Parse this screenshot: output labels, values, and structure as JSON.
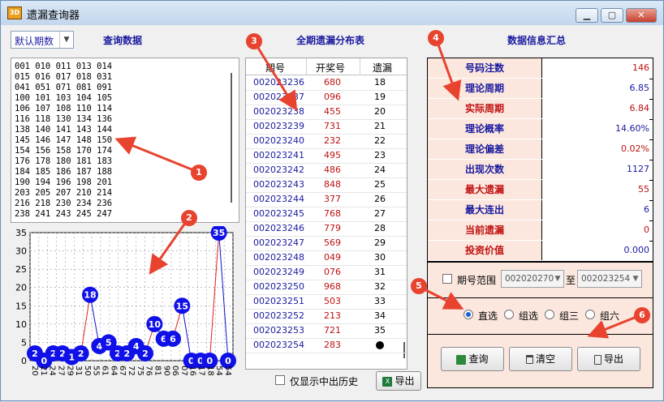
{
  "window": {
    "title": "遗漏查询器",
    "app_icon_text": "3D",
    "controls": {
      "minimize": "▁",
      "maximize": "▢",
      "close": "✕"
    }
  },
  "left_panel": {
    "period_select_value": "默认期数",
    "heading": "查询数据",
    "numbers_lines": [
      "001 010 011 013 014",
      "015 016 017 018 031",
      "041 051 071 081 091",
      "100 101 103 104 105",
      "106 107 108 110 114",
      "116 118 130 134 136",
      "138 140 141 143 144",
      "145 146 147 148 150",
      "154 156 158 170 174",
      "176 178 180 181 183",
      "184 185 186 187 188",
      "190 194 196 198 201",
      "203 205 207 210 214",
      "216 218 230 234 236",
      "238 241 243 245 247"
    ]
  },
  "chart_data": {
    "type": "line",
    "categories": [
      "20",
      "21",
      "24",
      "27",
      "29",
      "31",
      "50",
      "55",
      "61",
      "64",
      "67",
      "72",
      "75",
      "76",
      "81",
      "90",
      "06",
      "07",
      "16",
      "17",
      "18",
      "54",
      "54"
    ],
    "values": [
      2,
      0,
      2,
      2,
      1,
      2,
      18,
      4,
      5,
      2,
      2,
      4,
      2,
      10,
      6,
      6,
      15,
      0,
      0,
      0,
      35,
      0
    ],
    "ylim": [
      0,
      35
    ],
    "ytick_labels": [
      "0",
      "5",
      "10",
      "15",
      "20",
      "25",
      "30",
      "35"
    ],
    "grid": true,
    "colors": {
      "up": "#e02020",
      "down": "#1010d0",
      "marker": "#1010e8"
    }
  },
  "distribution": {
    "heading": "全期遗漏分布表",
    "columns": [
      "期号",
      "开奖号",
      "遗漏"
    ],
    "rows": [
      {
        "period": "002023236",
        "number": "680",
        "miss": "18"
      },
      {
        "period": "002023237",
        "number": "096",
        "miss": "19"
      },
      {
        "period": "002023238",
        "number": "455",
        "miss": "20"
      },
      {
        "period": "002023239",
        "number": "731",
        "miss": "21"
      },
      {
        "period": "002023240",
        "number": "232",
        "miss": "22"
      },
      {
        "period": "002023241",
        "number": "495",
        "miss": "23"
      },
      {
        "period": "002023242",
        "number": "486",
        "miss": "24"
      },
      {
        "period": "002023243",
        "number": "848",
        "miss": "25"
      },
      {
        "period": "002023244",
        "number": "377",
        "miss": "26"
      },
      {
        "period": "002023245",
        "number": "768",
        "miss": "27"
      },
      {
        "period": "002023246",
        "number": "779",
        "miss": "28"
      },
      {
        "period": "002023247",
        "number": "569",
        "miss": "29"
      },
      {
        "period": "002023248",
        "number": "049",
        "miss": "30"
      },
      {
        "period": "002023249",
        "number": "076",
        "miss": "31"
      },
      {
        "period": "002023250",
        "number": "968",
        "miss": "32"
      },
      {
        "period": "002023251",
        "number": "503",
        "miss": "33"
      },
      {
        "period": "002023252",
        "number": "213",
        "miss": "34"
      },
      {
        "period": "002023253",
        "number": "721",
        "miss": "35"
      },
      {
        "period": "002023254",
        "number": "283",
        "miss": ""
      }
    ],
    "only_hit_history_label": "仅显示中出历史",
    "export_label": "导出",
    "export_icon_text": "X"
  },
  "info": {
    "heading": "数据信息汇总",
    "rows": [
      {
        "key": "号码注数",
        "value": "146",
        "key_color": "#1a1aa0",
        "value_color": "#c01010"
      },
      {
        "key": "理论周期",
        "value": "6.85",
        "key_color": "#1a1aa0",
        "value_color": "#1a1aa0"
      },
      {
        "key": "实际周期",
        "value": "6.84",
        "key_color": "#c01010",
        "value_color": "#c01010"
      },
      {
        "key": "理论概率",
        "value": "14.60%",
        "key_color": "#1a1aa0",
        "value_color": "#1a1aa0"
      },
      {
        "key": "理论偏差",
        "value": "0.02%",
        "key_color": "#1a1aa0",
        "value_color": "#c01010"
      },
      {
        "key": "出现次数",
        "value": "1127",
        "key_color": "#1a1aa0",
        "value_color": "#1a1aa0"
      },
      {
        "key": "最大遗漏",
        "value": "55",
        "key_color": "#c01010",
        "value_color": "#c01010"
      },
      {
        "key": "最大连出",
        "value": "6",
        "key_color": "#1a1aa0",
        "value_color": "#1a1aa0"
      },
      {
        "key": "当前遗漏",
        "value": "0",
        "key_color": "#c01010",
        "value_color": "#c01010"
      },
      {
        "key": "投资价值",
        "value": "0.000",
        "key_color": "#c01010",
        "value_color": "#1a1aa0"
      }
    ]
  },
  "controls": {
    "range_label": "期号范围",
    "range_from": "002020270",
    "range_to_label": "至",
    "range_to": "002023254",
    "radios": [
      "直选",
      "组选",
      "组三",
      "组六"
    ],
    "selected_radio": "直选",
    "query_label": "查询",
    "clear_label": "清空",
    "export_label": "导出"
  },
  "annotations": [
    "1",
    "2",
    "3",
    "4",
    "5",
    "6"
  ]
}
